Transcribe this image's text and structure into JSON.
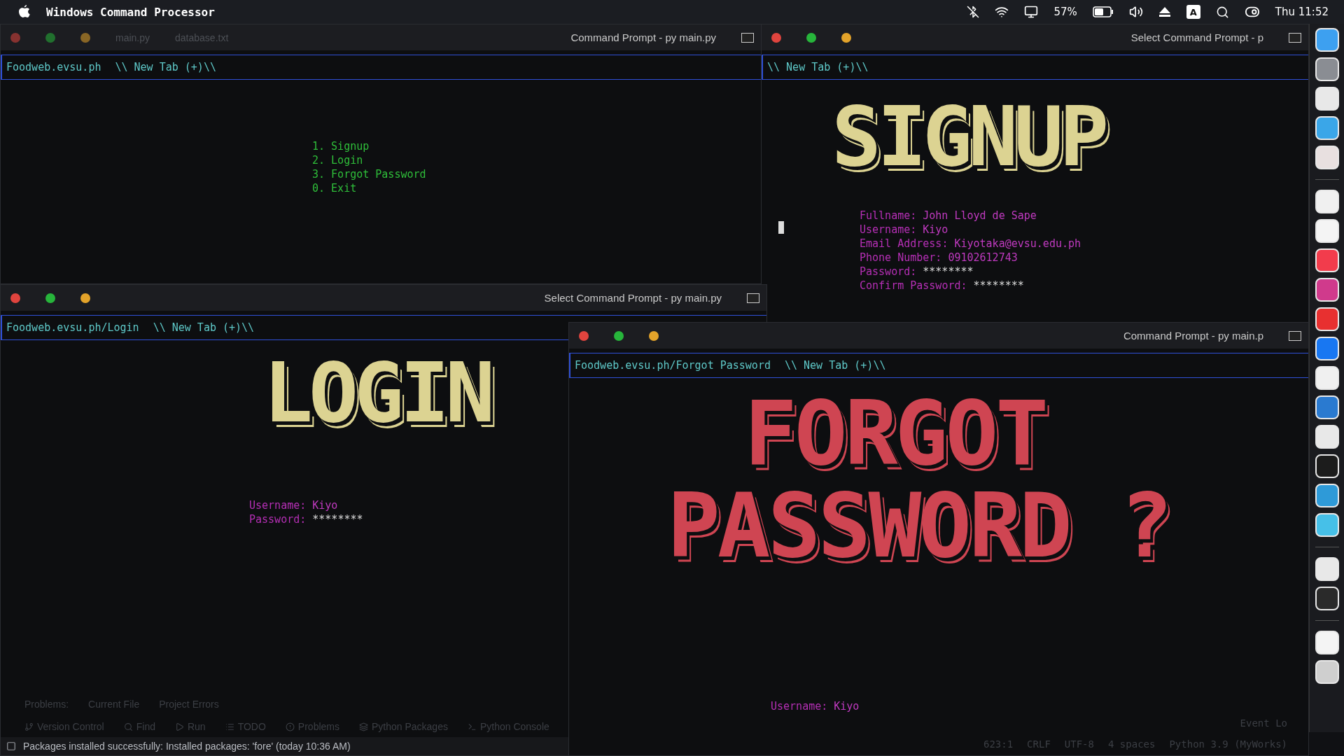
{
  "menu_bar": {
    "app_name": "Windows Command Processor",
    "battery_percent": "57%",
    "input_source": "A",
    "clock": "Thu 11:52"
  },
  "windows": [
    {
      "kind": "menu",
      "title": "Command Prompt - py  main.py",
      "ghost_tabs": [
        "main.py",
        "database.txt"
      ],
      "address": "Foodweb.evsu.ph",
      "new_tab": "\\\\ New Tab (+)\\\\",
      "menu_items": [
        "1. Signup",
        "2. Login",
        "3. Forgot Password",
        "0. Exit"
      ]
    },
    {
      "kind": "signup",
      "title": "Select Command Prompt - p",
      "new_tab": "\\\\ New Tab (+)\\\\",
      "banner": [
        "SIGNUP"
      ],
      "fields": [
        {
          "label": "Fullname:",
          "value": "John Lloyd de Sape",
          "masked": false
        },
        {
          "label": "Username:",
          "value": "Kiyo",
          "masked": false
        },
        {
          "label": "Email Address:",
          "value": "Kiyotaka@evsu.edu.ph",
          "masked": false
        },
        {
          "label": "Phone Number:",
          "value": "09102612743",
          "masked": false
        },
        {
          "label": "Password:",
          "value": "********",
          "masked": true
        },
        {
          "label": "Confirm Password:",
          "value": "********",
          "masked": true
        }
      ]
    },
    {
      "kind": "login",
      "title": "Select Command Prompt - py  main.py",
      "address": "Foodweb.evsu.ph/Login",
      "new_tab": "\\\\ New Tab (+)\\\\",
      "banner": [
        "LOGIN"
      ],
      "fields": [
        {
          "label": "Username:",
          "value": "Kiyo",
          "masked": false
        },
        {
          "label": "Password:",
          "value": "********",
          "masked": true
        }
      ]
    },
    {
      "kind": "forgot",
      "title": "Command Prompt - py  main.p",
      "address": "Foodweb.evsu.ph/Forgot Password",
      "new_tab": "\\\\ New Tab (+)\\\\",
      "banner": [
        "FORGOT",
        "PASSWORD ?"
      ],
      "fields": [
        {
          "label": "Username:",
          "value": "Kiyo",
          "masked": false
        }
      ]
    }
  ],
  "ide": {
    "problem_tabs": [
      "Problems:",
      "Current File",
      "Project Errors"
    ],
    "tool_tabs": [
      "Version Control",
      "Find",
      "Run",
      "TODO",
      "Problems",
      "Python Packages",
      "Python Console"
    ],
    "status_message": "Packages installed successfully: Installed packages: 'fore' (today 10:36 AM)",
    "status_items": [
      "623:1",
      "CRLF",
      "UTF-8",
      "4 spaces",
      "Python 3.9 (MyWorks)"
    ],
    "event_log": "Event Lo"
  }
}
